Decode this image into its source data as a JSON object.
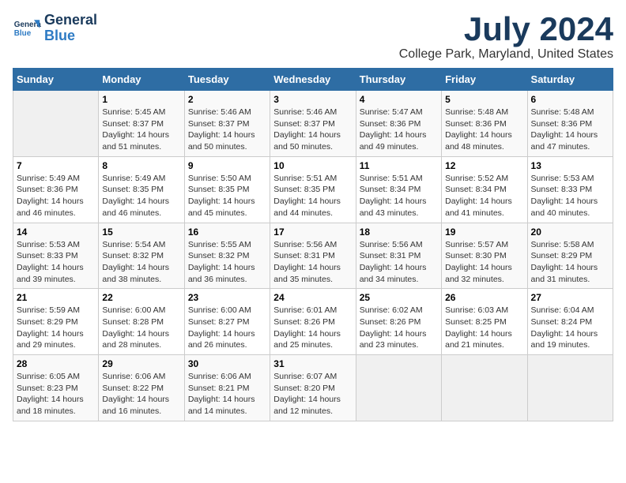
{
  "header": {
    "logo_line1": "General",
    "logo_line2": "Blue",
    "month": "July 2024",
    "location": "College Park, Maryland, United States"
  },
  "weekdays": [
    "Sunday",
    "Monday",
    "Tuesday",
    "Wednesday",
    "Thursday",
    "Friday",
    "Saturday"
  ],
  "weeks": [
    [
      {
        "day": "",
        "info": ""
      },
      {
        "day": "1",
        "info": "Sunrise: 5:45 AM\nSunset: 8:37 PM\nDaylight: 14 hours\nand 51 minutes."
      },
      {
        "day": "2",
        "info": "Sunrise: 5:46 AM\nSunset: 8:37 PM\nDaylight: 14 hours\nand 50 minutes."
      },
      {
        "day": "3",
        "info": "Sunrise: 5:46 AM\nSunset: 8:37 PM\nDaylight: 14 hours\nand 50 minutes."
      },
      {
        "day": "4",
        "info": "Sunrise: 5:47 AM\nSunset: 8:36 PM\nDaylight: 14 hours\nand 49 minutes."
      },
      {
        "day": "5",
        "info": "Sunrise: 5:48 AM\nSunset: 8:36 PM\nDaylight: 14 hours\nand 48 minutes."
      },
      {
        "day": "6",
        "info": "Sunrise: 5:48 AM\nSunset: 8:36 PM\nDaylight: 14 hours\nand 47 minutes."
      }
    ],
    [
      {
        "day": "7",
        "info": "Sunrise: 5:49 AM\nSunset: 8:36 PM\nDaylight: 14 hours\nand 46 minutes."
      },
      {
        "day": "8",
        "info": "Sunrise: 5:49 AM\nSunset: 8:35 PM\nDaylight: 14 hours\nand 46 minutes."
      },
      {
        "day": "9",
        "info": "Sunrise: 5:50 AM\nSunset: 8:35 PM\nDaylight: 14 hours\nand 45 minutes."
      },
      {
        "day": "10",
        "info": "Sunrise: 5:51 AM\nSunset: 8:35 PM\nDaylight: 14 hours\nand 44 minutes."
      },
      {
        "day": "11",
        "info": "Sunrise: 5:51 AM\nSunset: 8:34 PM\nDaylight: 14 hours\nand 43 minutes."
      },
      {
        "day": "12",
        "info": "Sunrise: 5:52 AM\nSunset: 8:34 PM\nDaylight: 14 hours\nand 41 minutes."
      },
      {
        "day": "13",
        "info": "Sunrise: 5:53 AM\nSunset: 8:33 PM\nDaylight: 14 hours\nand 40 minutes."
      }
    ],
    [
      {
        "day": "14",
        "info": "Sunrise: 5:53 AM\nSunset: 8:33 PM\nDaylight: 14 hours\nand 39 minutes."
      },
      {
        "day": "15",
        "info": "Sunrise: 5:54 AM\nSunset: 8:32 PM\nDaylight: 14 hours\nand 38 minutes."
      },
      {
        "day": "16",
        "info": "Sunrise: 5:55 AM\nSunset: 8:32 PM\nDaylight: 14 hours\nand 36 minutes."
      },
      {
        "day": "17",
        "info": "Sunrise: 5:56 AM\nSunset: 8:31 PM\nDaylight: 14 hours\nand 35 minutes."
      },
      {
        "day": "18",
        "info": "Sunrise: 5:56 AM\nSunset: 8:31 PM\nDaylight: 14 hours\nand 34 minutes."
      },
      {
        "day": "19",
        "info": "Sunrise: 5:57 AM\nSunset: 8:30 PM\nDaylight: 14 hours\nand 32 minutes."
      },
      {
        "day": "20",
        "info": "Sunrise: 5:58 AM\nSunset: 8:29 PM\nDaylight: 14 hours\nand 31 minutes."
      }
    ],
    [
      {
        "day": "21",
        "info": "Sunrise: 5:59 AM\nSunset: 8:29 PM\nDaylight: 14 hours\nand 29 minutes."
      },
      {
        "day": "22",
        "info": "Sunrise: 6:00 AM\nSunset: 8:28 PM\nDaylight: 14 hours\nand 28 minutes."
      },
      {
        "day": "23",
        "info": "Sunrise: 6:00 AM\nSunset: 8:27 PM\nDaylight: 14 hours\nand 26 minutes."
      },
      {
        "day": "24",
        "info": "Sunrise: 6:01 AM\nSunset: 8:26 PM\nDaylight: 14 hours\nand 25 minutes."
      },
      {
        "day": "25",
        "info": "Sunrise: 6:02 AM\nSunset: 8:26 PM\nDaylight: 14 hours\nand 23 minutes."
      },
      {
        "day": "26",
        "info": "Sunrise: 6:03 AM\nSunset: 8:25 PM\nDaylight: 14 hours\nand 21 minutes."
      },
      {
        "day": "27",
        "info": "Sunrise: 6:04 AM\nSunset: 8:24 PM\nDaylight: 14 hours\nand 19 minutes."
      }
    ],
    [
      {
        "day": "28",
        "info": "Sunrise: 6:05 AM\nSunset: 8:23 PM\nDaylight: 14 hours\nand 18 minutes."
      },
      {
        "day": "29",
        "info": "Sunrise: 6:06 AM\nSunset: 8:22 PM\nDaylight: 14 hours\nand 16 minutes."
      },
      {
        "day": "30",
        "info": "Sunrise: 6:06 AM\nSunset: 8:21 PM\nDaylight: 14 hours\nand 14 minutes."
      },
      {
        "day": "31",
        "info": "Sunrise: 6:07 AM\nSunset: 8:20 PM\nDaylight: 14 hours\nand 12 minutes."
      },
      {
        "day": "",
        "info": ""
      },
      {
        "day": "",
        "info": ""
      },
      {
        "day": "",
        "info": ""
      }
    ]
  ]
}
